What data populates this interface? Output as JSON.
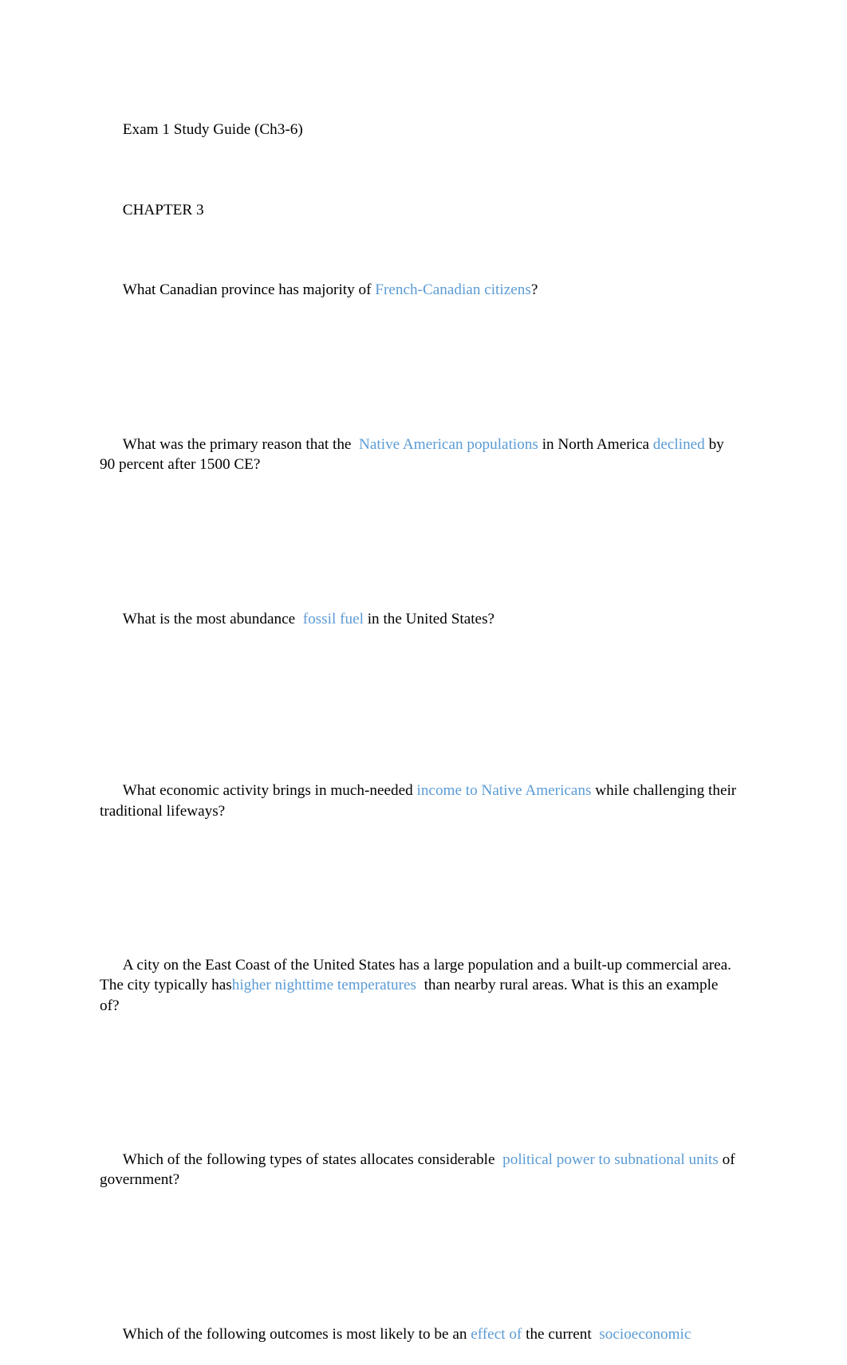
{
  "document": {
    "title_line": "Exam 1 Study Guide (Ch3-6)",
    "chapter_heading": "CHAPTER 3",
    "highlight_color": "#5B9BD5",
    "text_color": "#000000",
    "background_color": "#ffffff"
  },
  "questions": [
    {
      "id": "q1",
      "full_text": "What Canadian province has majority of French-Canadian citizens?",
      "segments": [
        {
          "text": "What Canadian province has majority of ",
          "style": "plain"
        },
        {
          "text": "French-Canadian citizens",
          "style": "highlight"
        },
        {
          "text": "?",
          "style": "plain"
        }
      ]
    },
    {
      "id": "q2",
      "full_text": "What was the primary reason that the  Native American populations in North America declined by 90 percent after 1500 CE?",
      "segments": [
        {
          "text": "What was the primary reason that the  ",
          "style": "plain"
        },
        {
          "text": "Native American populations",
          "style": "highlight"
        },
        {
          "text": " in North America ",
          "style": "plain"
        },
        {
          "text": "declined",
          "style": "highlight"
        },
        {
          "text": " by 90 percent after 1500 CE?",
          "style": "plain"
        }
      ]
    },
    {
      "id": "q3",
      "full_text": "What is the most abundance  fossil fuel in the United States?",
      "segments": [
        {
          "text": "What is the most abundance  ",
          "style": "plain"
        },
        {
          "text": "fossil fuel",
          "style": "highlight"
        },
        {
          "text": " in the United States?",
          "style": "plain"
        }
      ]
    },
    {
      "id": "q4",
      "full_text": "What economic activity brings in much-needed income to Native Americans while challenging their traditional lifeways?",
      "segments": [
        {
          "text": "What economic activity brings in much-needed ",
          "style": "plain"
        },
        {
          "text": "income to Native Americans",
          "style": "highlight"
        },
        {
          "text": " while challenging their traditional lifeways?",
          "style": "plain"
        }
      ]
    },
    {
      "id": "q5",
      "full_text": "A city on the East Coast of the United States has a large population and a built-up commercial area. The city typically has higher nighttime temperatures  than nearby rural areas. What is this an example of?",
      "segments": [
        {
          "text": "A city on the East Coast of the United States has a large population and a built-up commercial area. The city typically has",
          "style": "plain"
        },
        {
          "text": "higher nighttime temperatures",
          "style": "highlight"
        },
        {
          "text": "  than nearby rural areas. What is this an example of?",
          "style": "plain"
        }
      ]
    },
    {
      "id": "q6",
      "full_text": "Which of the following types of states allocates considerable  political power to subnational units of government?",
      "segments": [
        {
          "text": "Which of the following types of states allocates considerable  ",
          "style": "plain"
        },
        {
          "text": "political power to subnational units",
          "style": "highlight"
        },
        {
          "text": " of government?",
          "style": "plain"
        }
      ]
    },
    {
      "id": "q7",
      "full_text": "Which of the following outcomes is most likely to be an effect of the current  socioeconomic",
      "segments": [
        {
          "text": "Which of the following outcomes is most likely to be an ",
          "style": "plain"
        },
        {
          "text": "effect of",
          "style": "highlight"
        },
        {
          "text": " the current  ",
          "style": "plain"
        },
        {
          "text": "socioeconomic",
          "style": "highlight"
        }
      ]
    }
  ]
}
